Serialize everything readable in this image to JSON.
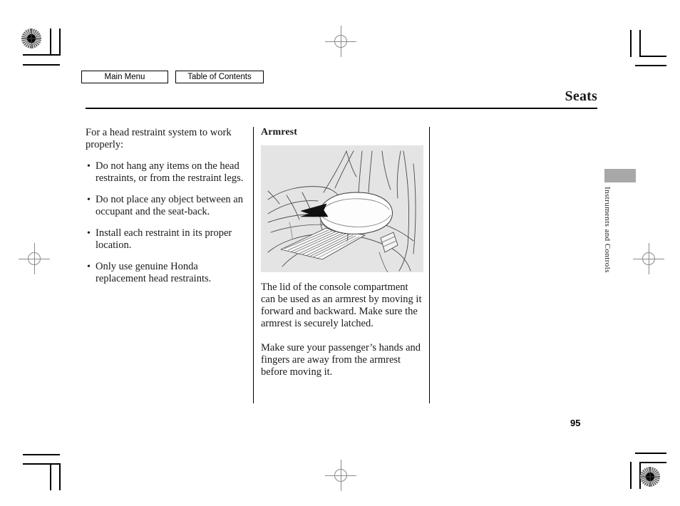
{
  "nav": {
    "main_menu_label": "Main Menu",
    "table_of_contents_label": "Table of Contents"
  },
  "header": {
    "title": "Seats"
  },
  "left_column": {
    "lead": "For a head restraint system to work properly:",
    "bullets": [
      "Do not hang any items on the head restraints, or from the restraint legs.",
      "Do not place any object between an occupant and the seat-back.",
      "Install each restraint in its proper location.",
      "Only use genuine Honda replacement head restraints."
    ]
  },
  "right_column": {
    "heading": "Armrest",
    "figure_alt": "center console armrest line drawing with arrow showing forward movement",
    "paragraphs": [
      "The lid of the console compartment can be used as an armrest by moving it forward and backward. Make sure the armrest is securely latched.",
      "Make sure your passenger’s hands and fingers are away from the armrest before moving it."
    ]
  },
  "side_tab": {
    "section_label": "Instruments and Controls",
    "tab_color": "#a8a8a8"
  },
  "footer": {
    "page_number": "95"
  },
  "print_marks": {
    "rosette_count": 2,
    "crosshair_count": 4
  }
}
